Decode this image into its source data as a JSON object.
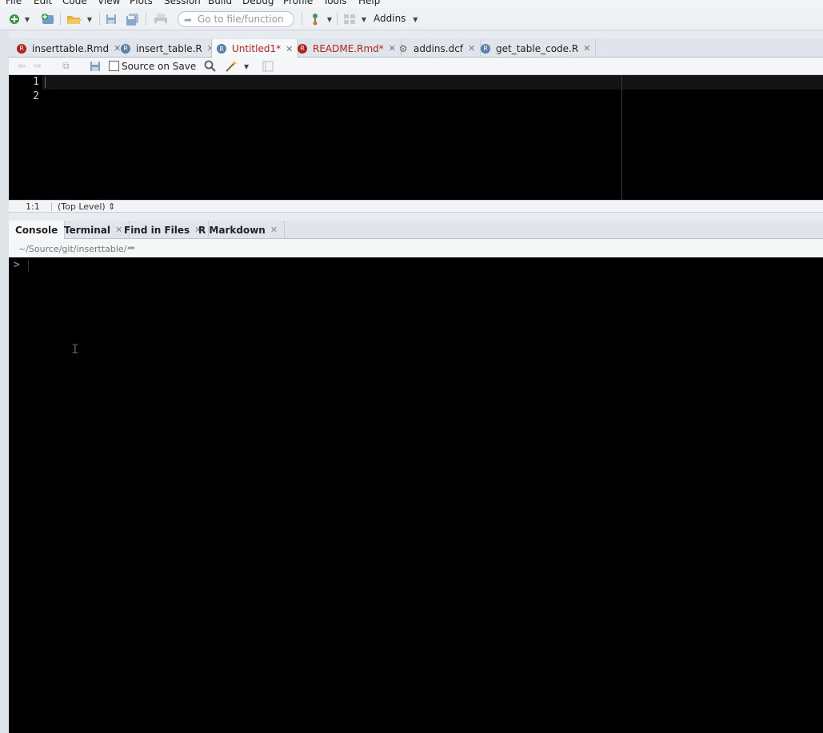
{
  "menu": [
    "File",
    "Edit",
    "Code",
    "View",
    "Plots",
    "Session",
    "Build",
    "Debug",
    "Profile",
    "Tools",
    "Help"
  ],
  "toolbar": {
    "goto_placeholder": "Go to file/function",
    "addins_label": "Addins"
  },
  "source": {
    "tabs": [
      {
        "label": "inserttable.Rmd",
        "type": "rmd",
        "modified": false
      },
      {
        "label": "insert_table.R",
        "type": "r",
        "modified": false
      },
      {
        "label": "Untitled1*",
        "type": "r",
        "modified": true,
        "active": true
      },
      {
        "label": "README.Rmd*",
        "type": "rmd",
        "modified": true
      },
      {
        "label": "addins.dcf",
        "type": "gear",
        "modified": false
      },
      {
        "label": "get_table_code.R",
        "type": "r",
        "modified": false
      }
    ],
    "source_on_save_label": "Source on Save",
    "line_numbers": [
      "1",
      "2"
    ],
    "status_position": "1:1",
    "status_scope": "(Top Level) ⇕"
  },
  "console": {
    "tabs": [
      "Console",
      "Terminal",
      "Find in Files",
      "R Markdown"
    ],
    "path": "~/Source/git/inserttable/",
    "prompt": ">"
  }
}
